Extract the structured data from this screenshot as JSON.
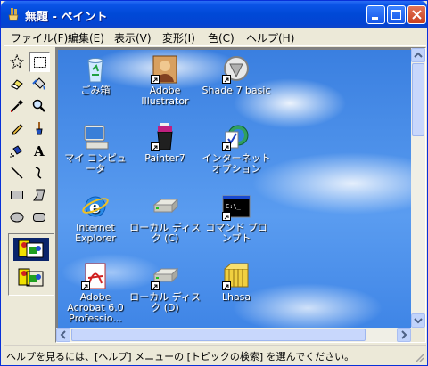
{
  "window": {
    "title": "無題 - ペイント"
  },
  "menu": [
    "ファイル(F)",
    "編集(E)",
    "表示(V)",
    "変形(I)",
    "色(C)",
    "ヘルプ(H)"
  ],
  "tools": [
    "free-form-select",
    "rect-select",
    "eraser",
    "fill",
    "color-picker",
    "magnifier",
    "pencil",
    "brush",
    "airbrush",
    "text",
    "line",
    "curve",
    "rectangle",
    "polygon",
    "ellipse",
    "rounded-rectangle"
  ],
  "selected_tool": "rect-select",
  "desktop_icons": [
    {
      "label": "ごみ箱",
      "icon": "recycle-bin-icon"
    },
    {
      "label": "Adobe Illustrator",
      "icon": "illustrator-icon"
    },
    {
      "label": "Shade 7 basic",
      "icon": "shade-icon"
    },
    {
      "label": "マイ コンピュータ",
      "icon": "my-computer-icon"
    },
    {
      "label": "Painter7",
      "icon": "painter-icon"
    },
    {
      "label": "インターネット オプション",
      "icon": "internet-options-icon"
    },
    {
      "label": "Internet Explorer",
      "icon": "internet-explorer-icon"
    },
    {
      "label": "ローカル ディスク (C)",
      "icon": "local-disk-icon"
    },
    {
      "label": "コマンド プロンプト",
      "icon": "command-prompt-icon"
    },
    {
      "label": "Adobe Acrobat 6.0 Professio...",
      "icon": "acrobat-icon"
    },
    {
      "label": "ローカル ディスク (D)",
      "icon": "local-disk-icon"
    },
    {
      "label": "Lhasa",
      "icon": "lhasa-icon"
    }
  ],
  "status": {
    "text": "ヘルプを見るには、[ヘルプ] メニューの [トピックの検索] を選んでください。"
  },
  "colors": {
    "title_bar": "#0a53e6",
    "window_face": "#ece9d8",
    "close_button": "#c9401f"
  }
}
